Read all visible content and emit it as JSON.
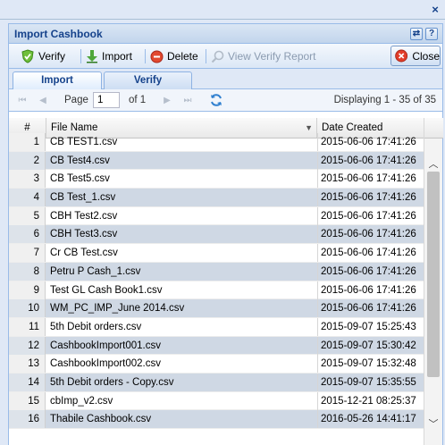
{
  "outer": {
    "close_icon": "×"
  },
  "window": {
    "title": "Import Cashbook",
    "refresh_icon": "⇄",
    "help_icon": "?"
  },
  "toolbar": {
    "verify_label": "Verify",
    "import_label": "Import",
    "delete_label": "Delete",
    "verify_report_label": "View Verify Report",
    "close_label": "Close"
  },
  "tabs": [
    {
      "label": "Import",
      "active": true
    },
    {
      "label": "Verify",
      "active": false
    }
  ],
  "pager": {
    "page_label": "Page",
    "page_value": "1",
    "of_label": "of 1",
    "display_text": "Displaying 1 - 35 of 35"
  },
  "grid": {
    "columns": [
      "#",
      "File Name",
      "Date Created"
    ],
    "rows": [
      {
        "num": "1",
        "name": "CB TEST1.csv",
        "date": "2015-06-06 17:41:26"
      },
      {
        "num": "2",
        "name": "CB Test4.csv",
        "date": "2015-06-06 17:41:26"
      },
      {
        "num": "3",
        "name": "CB Test5.csv",
        "date": "2015-06-06 17:41:26"
      },
      {
        "num": "4",
        "name": "CB Test_1.csv",
        "date": "2015-06-06 17:41:26"
      },
      {
        "num": "5",
        "name": "CBH Test2.csv",
        "date": "2015-06-06 17:41:26"
      },
      {
        "num": "6",
        "name": "CBH Test3.csv",
        "date": "2015-06-06 17:41:26"
      },
      {
        "num": "7",
        "name": "Cr CB Test.csv",
        "date": "2015-06-06 17:41:26"
      },
      {
        "num": "8",
        "name": "Petru P Cash_1.csv",
        "date": "2015-06-06 17:41:26"
      },
      {
        "num": "9",
        "name": "Test GL Cash Book1.csv",
        "date": "2015-06-06 17:41:26"
      },
      {
        "num": "10",
        "name": "WM_PC_IMP_June 2014.csv",
        "date": "2015-06-06 17:41:26"
      },
      {
        "num": "11",
        "name": "5th Debit orders.csv",
        "date": "2015-09-07 15:25:43"
      },
      {
        "num": "12",
        "name": "CashbookImport001.csv",
        "date": "2015-09-07 15:30:42"
      },
      {
        "num": "13",
        "name": "CashbookImport002.csv",
        "date": "2015-09-07 15:32:48"
      },
      {
        "num": "14",
        "name": "5th Debit orders - Copy.csv",
        "date": "2015-09-07 15:35:55"
      },
      {
        "num": "15",
        "name": "cbImp_v2.csv",
        "date": "2015-12-21 08:25:37"
      },
      {
        "num": "16",
        "name": "Thabile Cashbook.csv",
        "date": "2016-05-26 14:41:17"
      }
    ]
  }
}
